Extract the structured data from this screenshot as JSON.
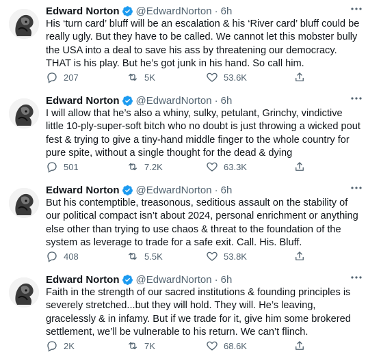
{
  "tweets": [
    {
      "name": "Edward Norton",
      "handle": "@EdwardNorton",
      "separator": "·",
      "time": "6h",
      "text": "His ‘turn card’ bluff will be an escalation & his ‘River card’ bluff could be really ugly. But they have to be called. We cannot let this mobster bully the USA into a deal to save his ass by threatening our democracy. THAT is his play. But he’s got junk in his hand. So call him.",
      "replies": "207",
      "retweets": "5K",
      "likes": "53.6K"
    },
    {
      "name": "Edward Norton",
      "handle": "@EdwardNorton",
      "separator": "·",
      "time": "6h",
      "text": "I will allow that he’s also a whiny, sulky, petulant, Grinchy, vindictive little 10-ply-super-soft bitch who no doubt is just throwing a wicked pout fest & trying to give a tiny-hand middle finger to the whole country for pure spite, without a single thought for the dead & dying",
      "replies": "501",
      "retweets": "7.2K",
      "likes": "63.3K"
    },
    {
      "name": "Edward Norton",
      "handle": "@EdwardNorton",
      "separator": "·",
      "time": "6h",
      "text": "But his contemptible, treasonous, seditious assault on the stability of our political compact isn’t about 2024, personal enrichment or anything else other than trying to use chaos & threat to the foundation of the system as leverage to trade for a safe exit. Call. His. Bluff.",
      "replies": "408",
      "retweets": "5.5K",
      "likes": "53.8K"
    },
    {
      "name": "Edward Norton",
      "handle": "@EdwardNorton",
      "separator": "·",
      "time": "6h",
      "text": "Faith in the strength of our sacred institutions & founding principles is severely stretched...but they will hold. They will. He’s leaving, gracelessly & in infamy. But if we trade for it, give him some brokered settlement, we’ll be vulnerable to his return. We can’t flinch.",
      "replies": "2K",
      "retweets": "7K",
      "likes": "68.6K"
    }
  ],
  "colors": {
    "verified": "#1d9bf0",
    "muted": "#536471",
    "text": "#0f1419"
  },
  "icons": [
    "verified-badge-icon",
    "more-icon",
    "reply-icon",
    "retweet-icon",
    "like-icon",
    "share-icon"
  ]
}
